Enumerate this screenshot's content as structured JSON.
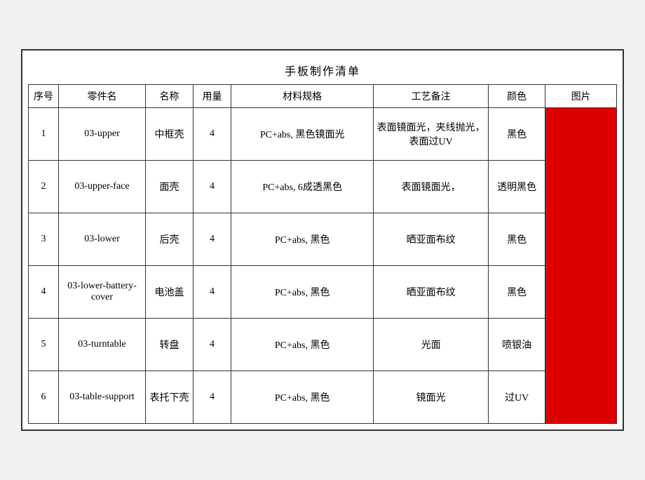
{
  "title": "手板制作清单",
  "headers": {
    "seq": "序号",
    "part_code": "零件名",
    "name": "名称",
    "qty": "用量",
    "spec": "材料规格",
    "craft": "工艺备注",
    "color": "颜色",
    "image": "图片"
  },
  "rows": [
    {
      "seq": "1",
      "part_code": "03-upper",
      "name": "中框壳",
      "qty": "4",
      "spec": "PC+abs, 黑色镜面光",
      "craft": "表面镜面光，夹线抛光，表面过UV",
      "color": "黑色"
    },
    {
      "seq": "2",
      "part_code": "03-upper-face",
      "name": "面壳",
      "qty": "4",
      "spec": "PC+abs, 6成透黑色",
      "craft": "表面镜面光，",
      "color": "透明黑色"
    },
    {
      "seq": "3",
      "part_code": "03-lower",
      "name": "后壳",
      "qty": "4",
      "spec": "PC+abs, 黑色",
      "craft": "晒亚面布纹",
      "color": "黑色"
    },
    {
      "seq": "4",
      "part_code": "03-lower-battery-cover",
      "name": "电池盖",
      "qty": "4",
      "spec": "PC+abs, 黑色",
      "craft": "晒亚面布纹",
      "color": "黑色"
    },
    {
      "seq": "5",
      "part_code": "03-turntable",
      "name": "转盘",
      "qty": "4",
      "spec": "PC+abs, 黑色",
      "craft": "光面",
      "color": "喷银油"
    },
    {
      "seq": "6",
      "part_code": "03-table-support",
      "name": "表托下壳",
      "qty": "4",
      "spec": "PC+abs, 黑色",
      "craft": "镜面光",
      "color": "过UV"
    }
  ]
}
